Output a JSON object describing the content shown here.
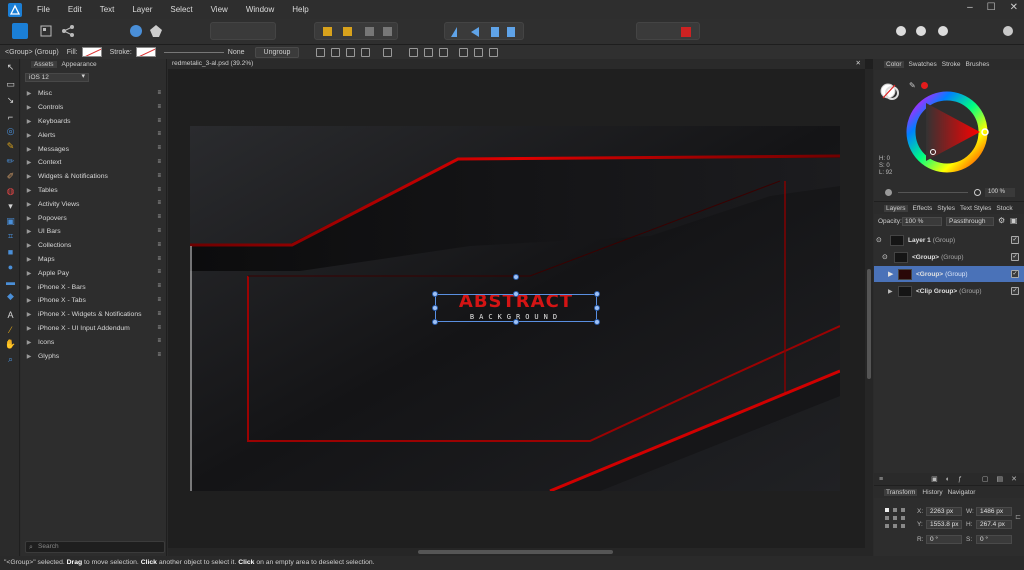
{
  "menubar": {
    "items": [
      "File",
      "Edit",
      "Text",
      "Layer",
      "Select",
      "View",
      "Window",
      "Help"
    ]
  },
  "context_bar": {
    "selection_label": "<Group> (Group)",
    "fill_label": "Fill:",
    "stroke_label": "Stroke:",
    "line_value": "None",
    "ungroup_label": "Ungroup"
  },
  "assets": {
    "tabs": [
      "Assets",
      "Appearance"
    ],
    "active_tab": "Assets",
    "dropdown_value": "iOS 12",
    "items": [
      "Misc",
      "Controls",
      "Keyboards",
      "Alerts",
      "Messages",
      "Context",
      "Widgets & Notifications",
      "Tables",
      "Activity Views",
      "Popovers",
      "UI Bars",
      "Collections",
      "Maps",
      "Apple Pay",
      "iPhone X - Bars",
      "iPhone X - Tabs",
      "iPhone X - Widgets & Notifications",
      "iPhone X - UI Input Addendum",
      "Icons",
      "Glyphs"
    ],
    "search_placeholder": "Search"
  },
  "document": {
    "tab_title": "redmetalic_3-al.psd (39.2%)",
    "artwork_title": "ABSTRACT",
    "artwork_subtitle": "BACKGROUND"
  },
  "color_panel": {
    "tabs": [
      "Color",
      "Swatches",
      "Stroke",
      "Brushes"
    ],
    "active_tab": "Color",
    "hsl": {
      "h": "H: 0",
      "s": "S: 0",
      "l": "L: 92"
    },
    "opacity": "100 %",
    "accent": "#e31c1c"
  },
  "layers_panel": {
    "tabs": [
      "Layers",
      "Effects",
      "Styles",
      "Text Styles",
      "Stock"
    ],
    "active_tab": "Layers",
    "opacity_label": "Opacity:",
    "opacity_value": "100 %",
    "blend_mode": "Passthrough",
    "layers": [
      {
        "name": "Layer 1",
        "type": "(Group)"
      },
      {
        "name": "<Group>",
        "type": "(Group)"
      },
      {
        "name": "<Group>",
        "type": "(Group)"
      },
      {
        "name": "<Clip Group>",
        "type": "(Group)"
      }
    ],
    "selected_color": "#4a72b8"
  },
  "transform_panel": {
    "tabs": [
      "Transform",
      "History",
      "Navigator"
    ],
    "active_tab": "Transform",
    "x_label": "X:",
    "x": "2263 px",
    "y_label": "Y:",
    "y": "1553.8 px",
    "w_label": "W:",
    "w": "1486 px",
    "h_label": "H:",
    "h": "267.4 px",
    "r_label": "R:",
    "r": "0 °",
    "s_label": "S:",
    "s": "0 °"
  },
  "status": {
    "prefix": "\"<Group>\" selected. ",
    "drag": "Drag",
    "drag_text": " to move selection. ",
    "click": "Click",
    "click_text": " another object to select it. ",
    "click2": "Click",
    "click2_text": " on an empty area to deselect selection."
  }
}
